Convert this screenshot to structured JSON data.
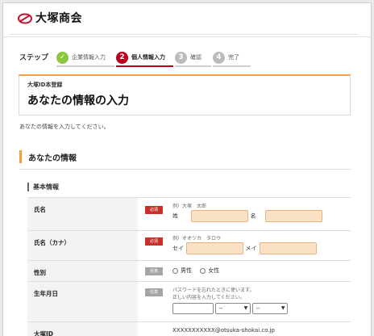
{
  "header": {
    "logo_text": "大塚商会"
  },
  "steps": {
    "label": "ステップ",
    "items": [
      {
        "num": "✓",
        "label": "企業情報入力",
        "state": "done",
        "color": "#8dc63f"
      },
      {
        "num": "2",
        "label": "個人情報入力",
        "state": "active",
        "color": "#b8001f"
      },
      {
        "num": "3",
        "label": "確認",
        "state": "todo",
        "color": "#bbbbbb"
      },
      {
        "num": "4",
        "label": "完了",
        "state": "todo",
        "color": "#bbbbbb"
      }
    ]
  },
  "title": {
    "sub": "大塚ID本登録",
    "main": "あなたの情報の入力"
  },
  "intro": "あなたの情報を入力してください。",
  "section": {
    "title": "あなたの情報"
  },
  "subsection": {
    "title": "基本情報"
  },
  "form": {
    "name": {
      "label": "氏名",
      "badge": "必須",
      "hint": "例）大塚　太郎",
      "last_label": "姓",
      "first_label": "名"
    },
    "kana": {
      "label": "氏名（カナ）",
      "badge": "必須",
      "hint": "例）オオツカ　タロウ",
      "last_label": "セイ",
      "first_label": "メイ"
    },
    "gender": {
      "label": "性別",
      "badge": "任意",
      "options": [
        "男性",
        "女性"
      ]
    },
    "birth": {
      "label": "生年月日",
      "badge": "任意",
      "hint1": "パスワードを忘れたときに使います。",
      "hint2": "正しい内容を入力してください。",
      "month_value": "--",
      "day_value": "--"
    },
    "otsuka_id": {
      "label": "大塚ID",
      "value": "XXXXXXXXXXX@otsuka-shokai.co.jp"
    }
  }
}
